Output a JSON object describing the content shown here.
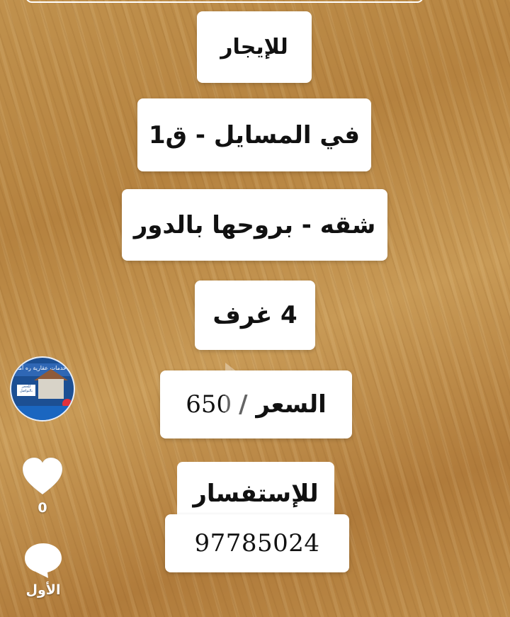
{
  "cards": {
    "for_rent": "للإيجار",
    "location": "في المسايل - ق1",
    "type": "شقه - بروحها بالدور",
    "rooms": "4 غرف",
    "price_label": "السعر /",
    "price_value": "650",
    "inquiry_label": "للإستفسار",
    "phone": "97785024"
  },
  "sidebar": {
    "avatar_banner": "خدمات عقارية ره أملاك الغيز",
    "avatar_box_text": "للحجز بالتواصل",
    "like_count": "0",
    "comment_label": "الأول"
  },
  "icons": [
    "play-icon",
    "heart-icon",
    "comment-icon"
  ],
  "colors": {
    "card_bg": "#ffffff",
    "text": "#111111",
    "avatar_accent": "#1c4f93",
    "heart_red": "#e2313b"
  }
}
